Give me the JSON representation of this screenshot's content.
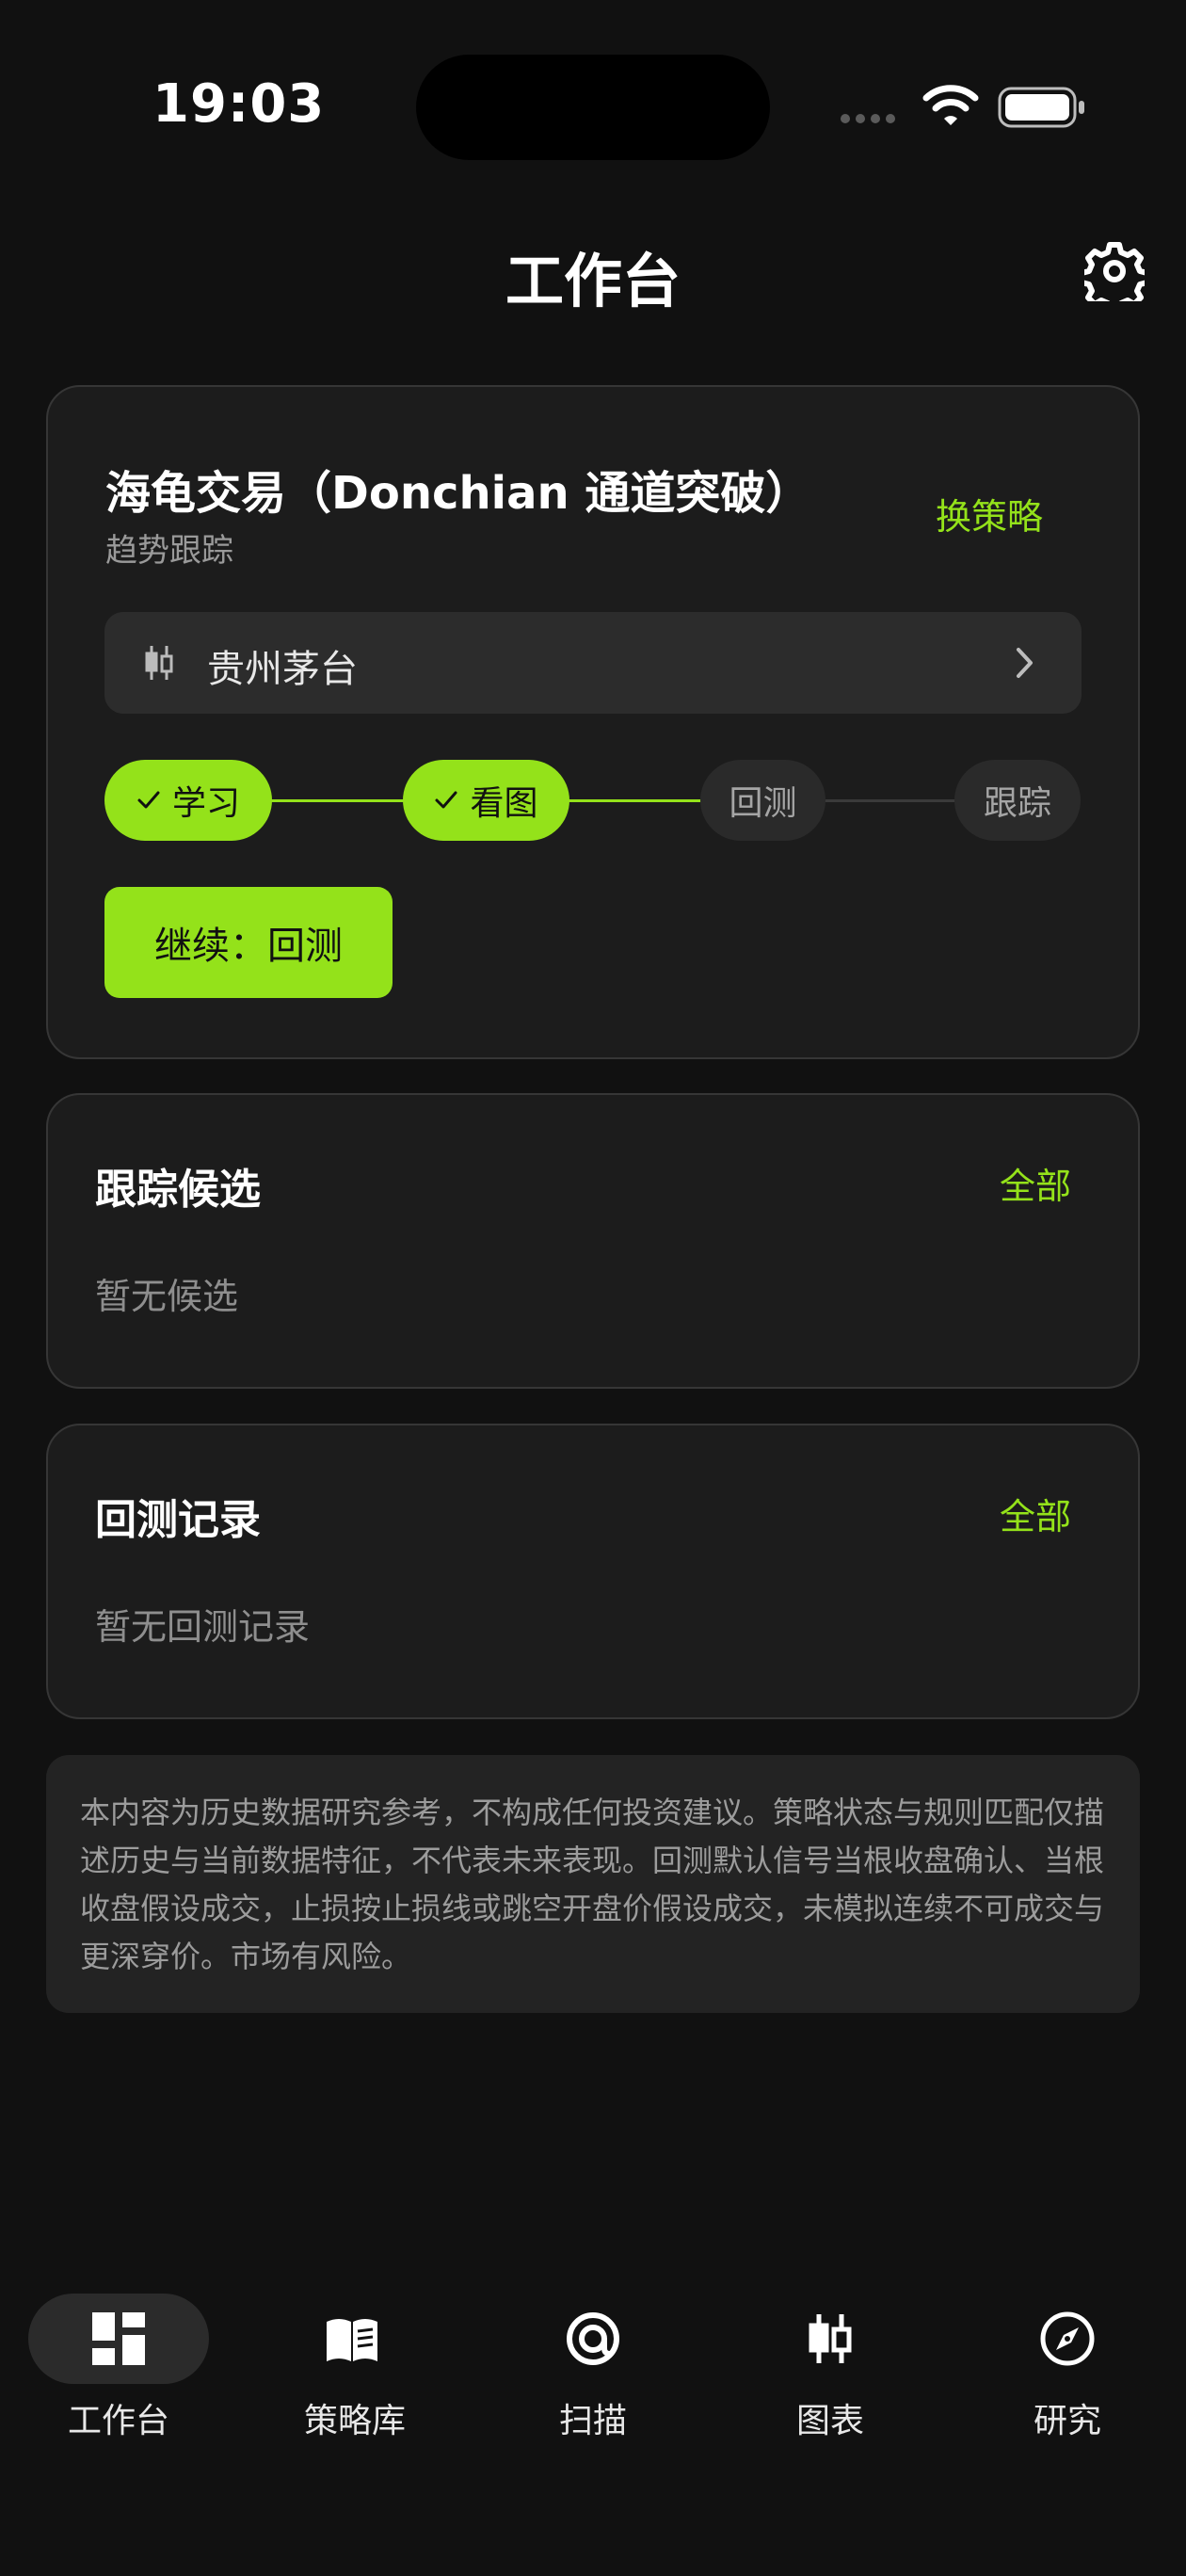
{
  "status": {
    "time": "19:03"
  },
  "header": {
    "title": "工作台",
    "settings_icon": "gear-icon"
  },
  "strategy_card": {
    "title": "海龟交易（Donchian 通道突破）",
    "subtitle": "趋势跟踪",
    "swap_label": "换策略",
    "stock_icon": "candlestick-icon",
    "stock_name": "贵州茅台",
    "steps": [
      {
        "label": "学习",
        "done": true
      },
      {
        "label": "看图",
        "done": true
      },
      {
        "label": "回测",
        "done": false
      },
      {
        "label": "跟踪",
        "done": false
      }
    ],
    "continue_label": "继续：回测"
  },
  "tracking": {
    "title": "跟踪候选",
    "all_label": "全部",
    "empty_text": "暂无候选"
  },
  "backtest": {
    "title": "回测记录",
    "all_label": "全部",
    "empty_text": "暂无回测记录"
  },
  "disclaimer": "本内容为历史数据研究参考，不构成任何投资建议。策略状态与规则匹配仅描述历史与当前数据特征，不代表未来表现。回测默认信号当根收盘确认、当根收盘假设成交，止损按止损线或跳空开盘价假设成交，未模拟连续不可成交与更深穿价。市场有风险。",
  "nav": {
    "items": [
      {
        "label": "工作台",
        "icon": "dashboard-icon",
        "active": true
      },
      {
        "label": "策略库",
        "icon": "book-icon",
        "active": false
      },
      {
        "label": "扫描",
        "icon": "scan-icon",
        "active": false
      },
      {
        "label": "图表",
        "icon": "candlestick-icon",
        "active": false
      },
      {
        "label": "研究",
        "icon": "compass-icon",
        "active": false
      }
    ]
  },
  "colors": {
    "accent": "#94e21a",
    "background": "#111111",
    "card": "#1c1c1c"
  }
}
